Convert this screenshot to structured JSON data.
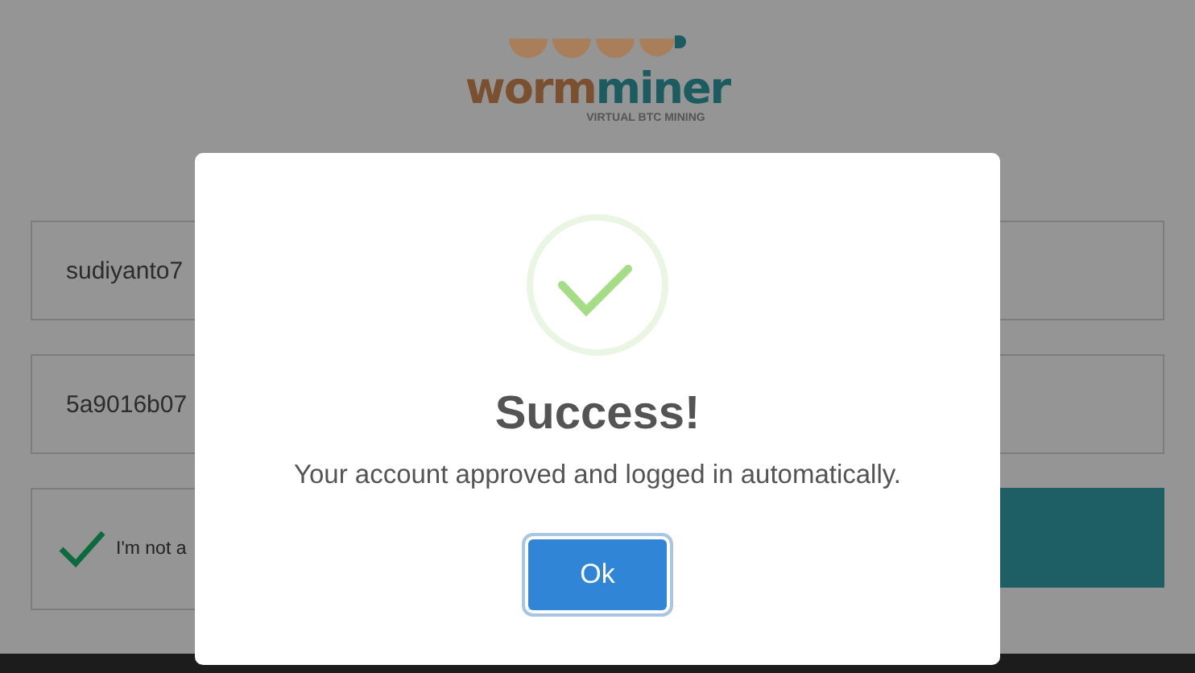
{
  "logo": {
    "word_1": "worm",
    "word_2": "miner",
    "tagline": "VIRTUAL BTC MINING"
  },
  "fields": [
    {
      "value": "sudiyanto7"
    },
    {
      "value": "5a9016b07"
    }
  ],
  "captcha": {
    "label": "I'm not a",
    "checked": true
  },
  "dialog": {
    "title": "Success!",
    "message": "Your account approved and logged in automatically.",
    "button": "Ok"
  }
}
